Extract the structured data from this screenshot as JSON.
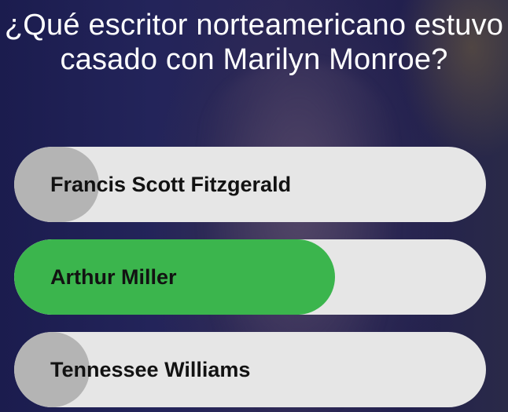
{
  "question": {
    "text": "¿Qué escritor norteamericano estuvo casado con Marilyn Monroe?"
  },
  "answers": [
    {
      "label": "Francis Scott Fitzgerald",
      "percent": 18,
      "state": "neutral"
    },
    {
      "label": "Arthur Miller",
      "percent": 68,
      "state": "correct"
    },
    {
      "label": "Tennessee Williams",
      "percent": 16,
      "state": "neutral"
    }
  ],
  "colors": {
    "correct": "#3bb54d",
    "neutral_fill": "#b4b4b4",
    "track": "#e6e6e6",
    "question_text": "#ffffff"
  }
}
